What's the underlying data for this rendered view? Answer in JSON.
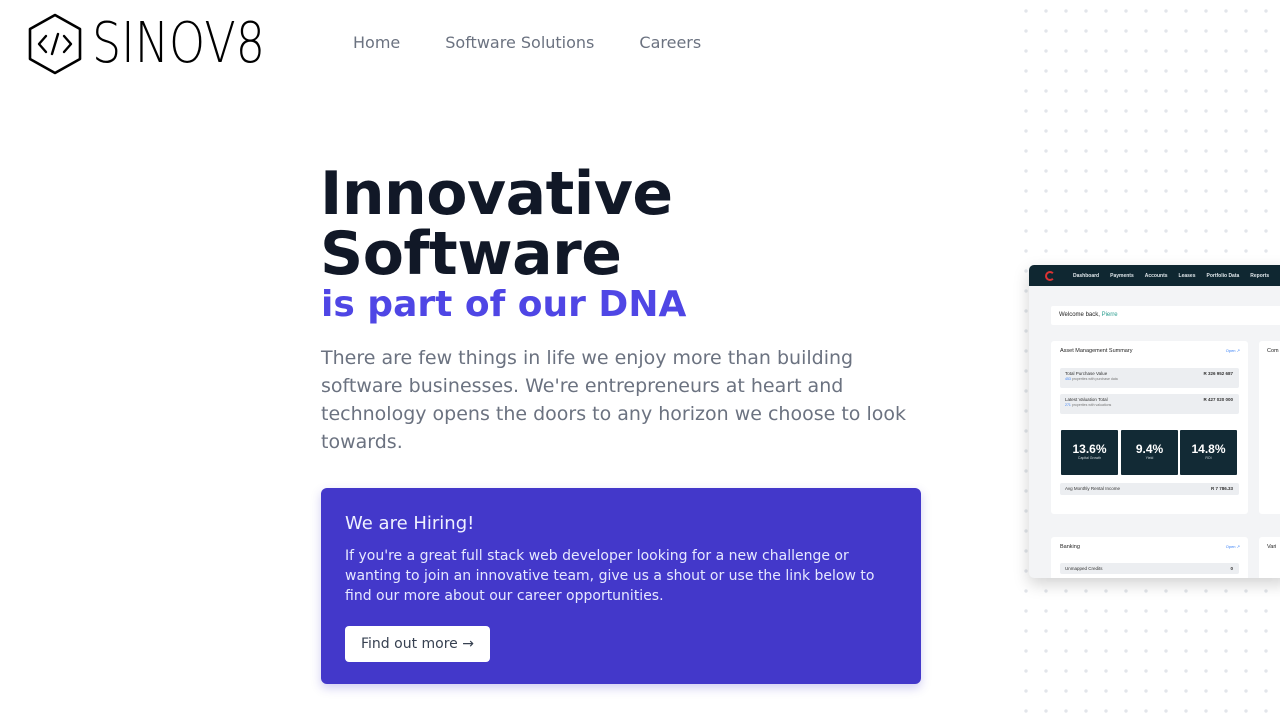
{
  "brand": {
    "name": "SINOV8",
    "icon": "code-hexagon-icon"
  },
  "nav": {
    "items": [
      {
        "label": "Home"
      },
      {
        "label": "Software Solutions"
      },
      {
        "label": "Careers"
      }
    ]
  },
  "hero": {
    "title_line1": "Innovative",
    "title_line2": "Software",
    "subtitle": "is part of our DNA",
    "description": "There are few things in life we enjoy more than building software businesses. We're entrepreneurs at heart and technology opens the doors to any horizon we choose to look towards."
  },
  "hiring": {
    "title": "We are Hiring!",
    "text": "If you're a great full stack web developer looking for a new challenge or wanting to join an innovative team, give us a shout or use the link below to find our more about our career opportunities.",
    "button_label": "Find out more →"
  },
  "preview": {
    "nav_items": [
      "Dashboard",
      "Payments",
      "Accounts",
      "Leases",
      "Portfolio Data",
      "Reports"
    ],
    "welcome_prefix": "Welcome back, ",
    "welcome_name": "Pierre",
    "asset_card": {
      "title": "Asset Management Summary",
      "open_label": "Open ↗",
      "rows": [
        {
          "label": "Total Purchase Value",
          "value": "R 326 952 687",
          "sub_count": "453",
          "sub_text": " properties with purchase data"
        },
        {
          "label": "Latest Valuation Total",
          "value": "R 427 020 000",
          "sub_count": "271",
          "sub_text": " properties with valuations"
        }
      ],
      "stats": [
        {
          "value": "13.6%",
          "label": "Capital Growth"
        },
        {
          "value": "9.4%",
          "label": "Yield"
        },
        {
          "value": "14.8%",
          "label": "ROI"
        }
      ],
      "rent_label": "Avg Monthly Rental Income",
      "rent_value": "R 7 786.33"
    },
    "side_card_title": "Com",
    "banking_card": {
      "title": "Banking",
      "open_label": "Open ↗",
      "row_label": "Unmapped Credits",
      "row_value": "0"
    },
    "vari_title": "Vari"
  },
  "colors": {
    "accent": "#4f46e5",
    "card_bg": "#4338ca",
    "heading": "#111827",
    "muted": "#6b7280",
    "dashboard_nav": "#0f2731"
  }
}
